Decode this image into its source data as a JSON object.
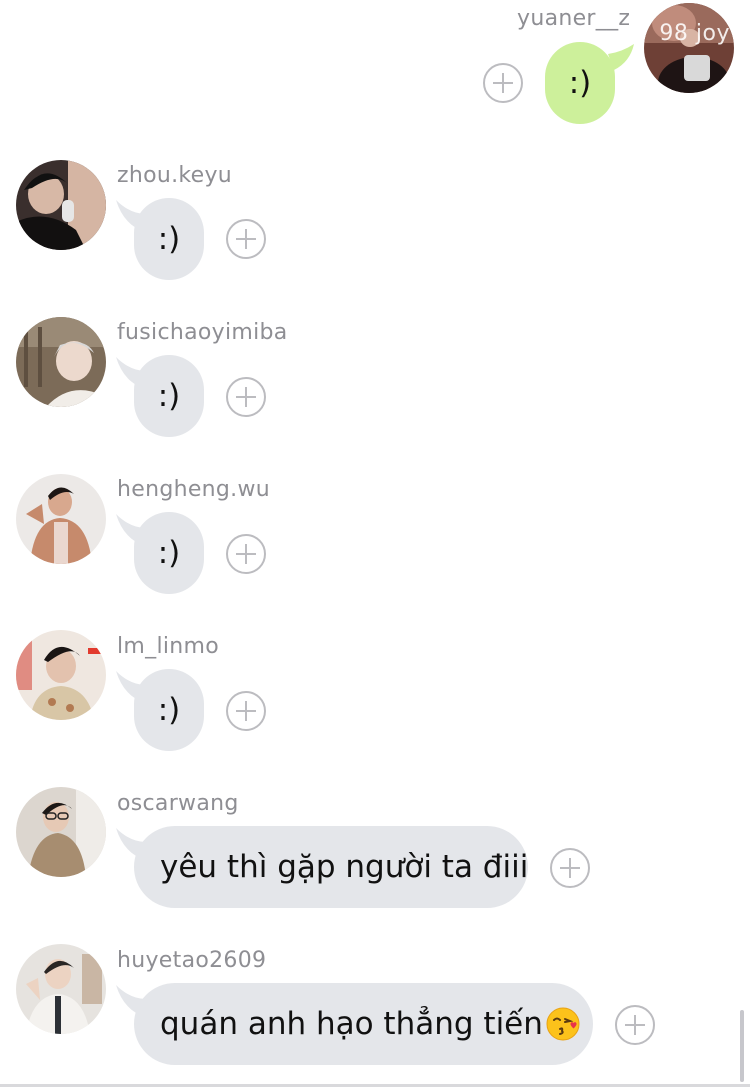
{
  "messages": [
    {
      "user": "yuaner__z",
      "text": ":)",
      "mine": true,
      "avatar_caption": "98 joy",
      "avatar_colors": [
        "#7a4a3e",
        "#2b1a18",
        "#b9a49a"
      ]
    },
    {
      "user": "zhou.keyu",
      "text": ":)",
      "mine": false,
      "avatar_colors": [
        "#3a2f2d",
        "#151212",
        "#d7b8a6"
      ]
    },
    {
      "user": "fusichaoyimiba",
      "text": ":)",
      "mine": false,
      "avatar_colors": [
        "#8a7a66",
        "#5b4b3d",
        "#e7ddd2"
      ]
    },
    {
      "user": "hengheng.wu",
      "text": ":)",
      "mine": false,
      "avatar_colors": [
        "#e9e6e4",
        "#c2876a",
        "#2b1f1c"
      ]
    },
    {
      "user": "lm_linmo",
      "text": ":)",
      "mine": false,
      "avatar_colors": [
        "#f0e8e2",
        "#c9b79a",
        "#1f1a18"
      ]
    },
    {
      "user": "oscarwang",
      "text": "yêu thì gặp người ta điii",
      "mine": false,
      "avatar_colors": [
        "#d9d3cc",
        "#a38a6c",
        "#2a2420"
      ]
    },
    {
      "user": "huyetao2609",
      "text": "quán anh hạo thẳng tiến",
      "mine": false,
      "emoji": "kissing-face-emoji",
      "avatar_colors": [
        "#e5e2de",
        "#30343a",
        "#d9c1b0"
      ]
    }
  ],
  "colors": {
    "my_bubble": "#cdf09b",
    "other_bubble": "#e4e6ea",
    "username": "#8e8e93",
    "react_icon": "#bcbcc0"
  }
}
